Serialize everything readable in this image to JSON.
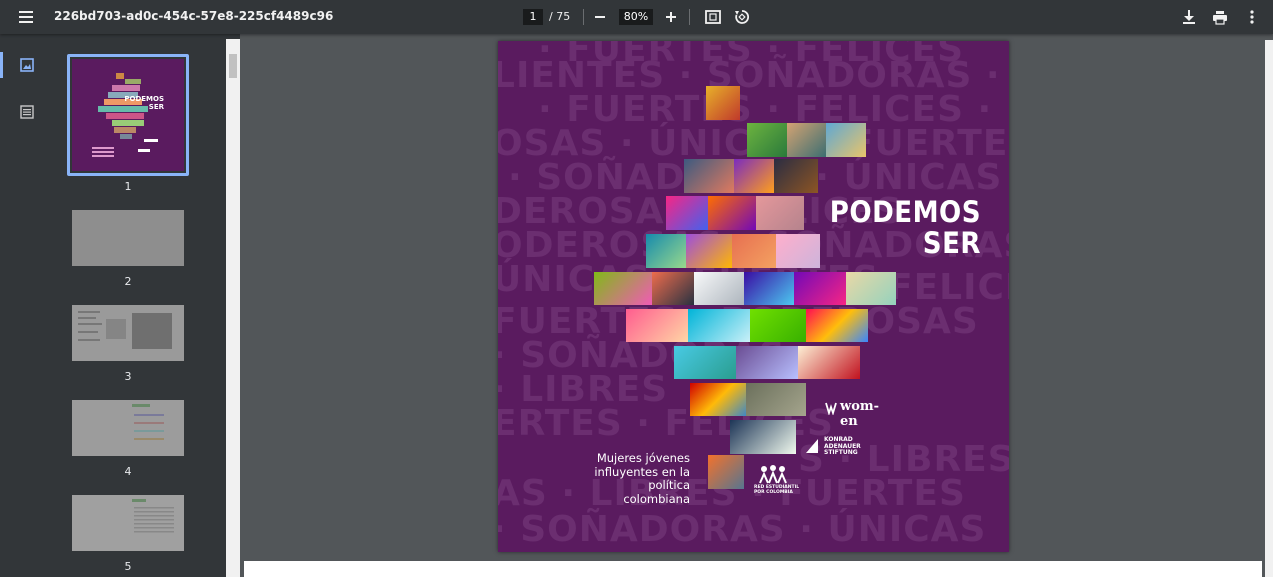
{
  "toolbar": {
    "title": "226bd703-ad0c-454c-57e8-225cf4489c96",
    "current_page": "1",
    "total_pages": "/ 75",
    "zoom": "80%"
  },
  "sidebar": {
    "thumbnails": [
      {
        "label": "1"
      },
      {
        "label": "2"
      },
      {
        "label": "3"
      },
      {
        "label": "4"
      },
      {
        "label": "5"
      }
    ]
  },
  "cover": {
    "headline_line1": "PODEMOS",
    "headline_line2": "SER",
    "subtitle_line1": "Mujeres jóvenes",
    "subtitle_line2": "influyentes en la",
    "subtitle_line3": "política colombiana",
    "background_words": [
      "· FUERTES · FELICES",
      "LIENTES · SOÑADORAS · PODE",
      "· FUERTES · FELICES · PODER",
      "OSAS · ÚNICAS · FUERTES",
      "· SOÑADORAS · ÚNICAS",
      "DEROSAS · FELICES",
      "ODEROSAS · SOÑADORAS",
      "ÚNICAS · FUERTES",
      "FELICES",
      "FUERTES · PODEROSAS",
      "· SOÑADORAS",
      "· LIBRES",
      "ERTES · FELICES",
      "S · LIBRES · ÚNICAS",
      "AS · LIBRES · FUERTES",
      "· SOÑADORAS · ÚNICAS"
    ],
    "logo_women": "wom-en",
    "logo_kas_1": "KONRAD",
    "logo_kas_2": "ADENAUER",
    "logo_kas_3": "STIFTUNG",
    "logo_red_1": "RED ESTUDIANTIL",
    "logo_red_2": "POR COLOMBIA",
    "colors": {
      "cover_bg": "#5a1b5f",
      "toolbar_bg": "#323639",
      "viewer_bg": "#525659",
      "accent": "#8ab4f8"
    }
  }
}
